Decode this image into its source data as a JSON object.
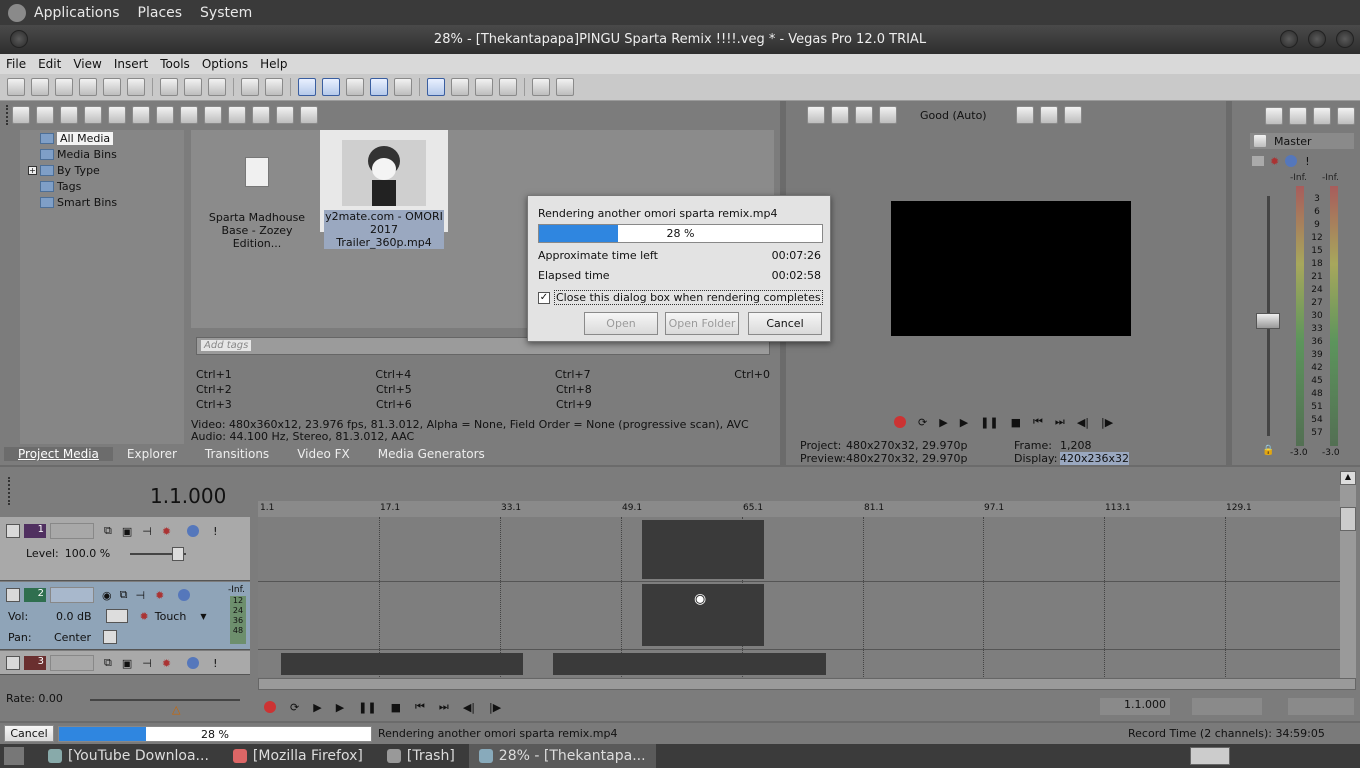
{
  "gnome_panel": {
    "applications": "Applications",
    "places": "Places",
    "system": "System"
  },
  "window": {
    "title": "28% - [Thekantapapa]PINGU Sparta Remix !!!!.veg * - Vegas Pro 12.0 TRIAL"
  },
  "menu": {
    "file": "File",
    "edit": "Edit",
    "view": "View",
    "insert": "Insert",
    "tools": "Tools",
    "options": "Options",
    "help": "Help"
  },
  "media_tree": {
    "items": [
      "All Media",
      "Media Bins",
      "By Type",
      "Tags",
      "Smart Bins"
    ]
  },
  "media_files": [
    {
      "name": "Sparta Madhouse Base - Zozey Edition..."
    },
    {
      "name": "y2mate.com - OMORI 2017 Trailer_360p.mp4"
    }
  ],
  "tags": {
    "placeholder": "Add tags"
  },
  "shortcuts": [
    [
      "Ctrl+1",
      "Ctrl+4",
      "Ctrl+7",
      "Ctrl+0"
    ],
    [
      "Ctrl+2",
      "Ctrl+5",
      "Ctrl+8",
      ""
    ],
    [
      "Ctrl+3",
      "Ctrl+6",
      "Ctrl+9",
      ""
    ]
  ],
  "media_info": {
    "video": "Video: 480x360x12, 23.976 fps, 81.3.012, Alpha = None, Field Order = None (progressive scan), AVC",
    "audio": "Audio: 44.100 Hz, Stereo, 81.3.012, AAC"
  },
  "media_tabs": [
    "Project Media",
    "Explorer",
    "Transitions",
    "Video FX",
    "Media Generators"
  ],
  "preview": {
    "quality": "Good (Auto)",
    "project_label": "Project:",
    "project_value": "480x270x32, 29.970p",
    "preview_label": "Preview:",
    "preview_value": "480x270x32, 29.970p",
    "frame_label": "Frame:",
    "frame_value": "1,208",
    "display_label": "Display:",
    "display_value": "420x236x32"
  },
  "master": {
    "title": "Master",
    "inf_left": "-Inf.",
    "inf_right": "-Inf.",
    "scale": [
      "3",
      "6",
      "9",
      "12",
      "15",
      "18",
      "21",
      "24",
      "27",
      "30",
      "33",
      "36",
      "39",
      "42",
      "45",
      "48",
      "51",
      "54",
      "57"
    ],
    "bottom_left": "-3.0",
    "bottom_right": "-3.0"
  },
  "dialog": {
    "title": "Rendering another omori sparta remix.mp4",
    "progress": 0.28,
    "progress_label": "28 %",
    "time_left_label": "Approximate time left",
    "time_left": "00:07:26",
    "elapsed_label": "Elapsed time",
    "elapsed": "00:02:58",
    "close_checkbox": "Close this dialog box when rendering completes",
    "open_btn": "Open",
    "open_folder_btn": "Open Folder",
    "cancel_btn": "Cancel"
  },
  "timeline": {
    "time": "1.1.000",
    "ruler": [
      "1.1",
      "17.1",
      "33.1",
      "49.1",
      "65.1",
      "81.1",
      "97.1",
      "113.1",
      "129.1"
    ],
    "track1": {
      "num": "1",
      "level_label": "Level:",
      "level_value": "100.0 %"
    },
    "track2": {
      "num": "2",
      "vol_label": "Vol:",
      "vol_value": "0.0 dB",
      "pan_label": "Pan:",
      "pan_value": "Center",
      "mode": "Touch",
      "inf": "-Inf.",
      "meter": [
        "12",
        "24",
        "36",
        "48"
      ]
    },
    "track3": {
      "num": "3"
    },
    "rate": "Rate: 0.00",
    "end_time": "1.1.000"
  },
  "status": {
    "cancel": "Cancel",
    "progress": 0.28,
    "progress_label": "28 %",
    "message": "Rendering another omori sparta remix.mp4",
    "record_time": "Record Time (2 channels): 34:59:05"
  },
  "taskbar": {
    "items": [
      "[YouTube Downloa...",
      "[Mozilla Firefox]",
      "[Trash]",
      "28% - [Thekantapa..."
    ]
  }
}
